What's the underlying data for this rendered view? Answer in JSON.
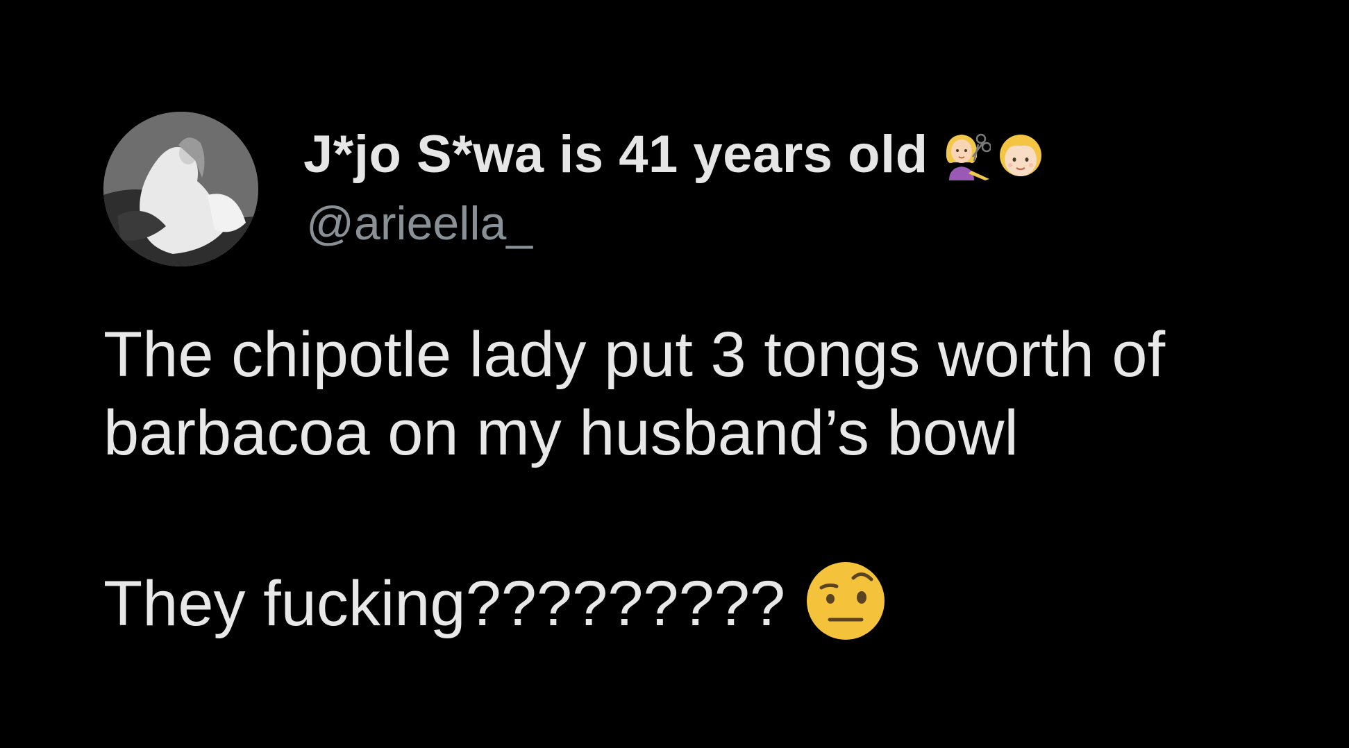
{
  "tweet": {
    "author": {
      "display_name": "J*jo S*wa is 41 years old",
      "name_emojis": [
        "woman-getting-haircut-emoji",
        "blond-child-face-emoji"
      ],
      "handle": "@arieella_",
      "avatar": "black-and-white-portrait-photo"
    },
    "text_lines": [
      "The chipotle lady put 3 tongs worth of",
      "barbacoa on my husband’s bowl",
      "",
      "They fucking?????????"
    ],
    "trailing_emoji": "face-with-raised-eyebrow-emoji"
  },
  "colors": {
    "background": "#000000",
    "primary_text": "#e8e8e8",
    "handle_text": "#8a9196",
    "emoji_yellow": "#f5c33b"
  }
}
